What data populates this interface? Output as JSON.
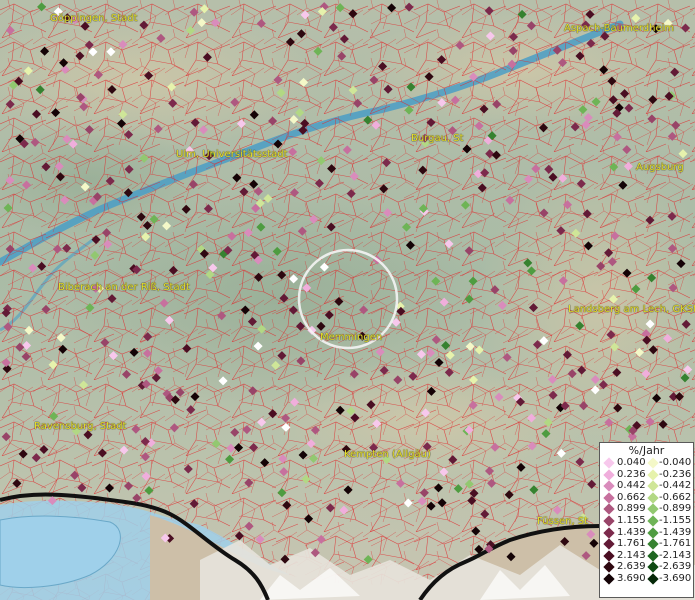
{
  "map": {
    "cities": [
      {
        "name": "Göppingen, Stadt"
      },
      {
        "name": "Aspach-Baumerdheim"
      },
      {
        "name": "Ulm, Universitätsstadt"
      },
      {
        "name": "Burgau, St"
      },
      {
        "name": "Augsburg"
      },
      {
        "name": "Biberach an der Riß, Stadt"
      },
      {
        "name": "Memmingen"
      },
      {
        "name": "Landsberg am Lech, GKSt"
      },
      {
        "name": "Ravensburg, Stadt"
      },
      {
        "name": "Kempten (Allgäu)"
      },
      {
        "name": "Füssen, St"
      }
    ],
    "colors": {
      "city_label": "#e6df2a",
      "boundary": "#e0262a",
      "river": "#4a9ec6",
      "lake": "#9fd0ea",
      "highlight_circle": "#f4f4f4"
    }
  },
  "legend": {
    "title": "%/Jahr",
    "positive": [
      "0.040",
      "0.236",
      "0.442",
      "0.662",
      "0.899",
      "1.155",
      "1.439",
      "1.761",
      "2.143",
      "2.639",
      "3.690"
    ],
    "negative": [
      "-0.040",
      "-0.236",
      "-0.442",
      "-0.662",
      "-0.899",
      "-1.155",
      "-1.439",
      "-1.761",
      "-2.143",
      "-2.639",
      "-3.690"
    ],
    "positive_colors": [
      "#f7c8ec",
      "#f0aedc",
      "#d98cbc",
      "#c7709e",
      "#ae5880",
      "#984468",
      "#7c2a4c",
      "#621a36",
      "#4a0e22",
      "#2e0810",
      "#140306"
    ],
    "negative_colors": [
      "#f4f8c8",
      "#e6f2ac",
      "#cfe698",
      "#b2d884",
      "#92c870",
      "#6eb456",
      "#4e9c40",
      "#368230",
      "#1e6620",
      "#0e4a12",
      "#052808"
    ]
  }
}
